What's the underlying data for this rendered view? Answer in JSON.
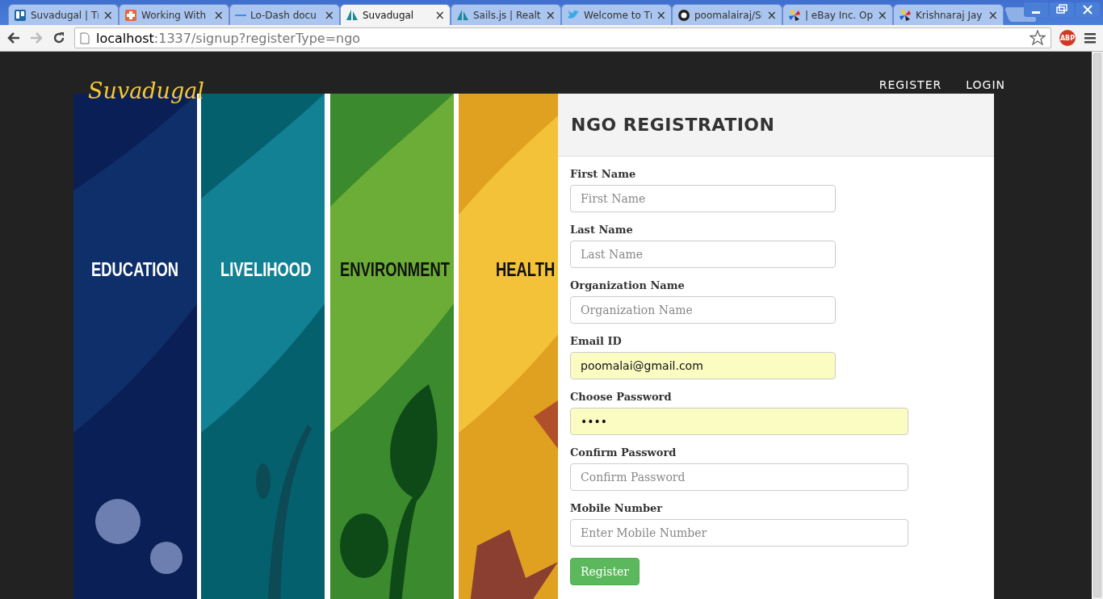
{
  "browser": {
    "tabs": [
      {
        "title": "Suvadugal | Tı",
        "selected": false
      },
      {
        "title": "Working With",
        "selected": false
      },
      {
        "title": "Lo-Dash docu",
        "selected": false
      },
      {
        "title": "Suvadugal",
        "selected": true
      },
      {
        "title": "Sails.js | Realt",
        "selected": false
      },
      {
        "title": "Welcome to Tı",
        "selected": false
      },
      {
        "title": "poomalairaj/Sı",
        "selected": false
      },
      {
        "title": "| eBay Inc. Op",
        "selected": false
      },
      {
        "title": "Krishnaraj Jay",
        "selected": false
      }
    ],
    "close_glyph": "×",
    "address": {
      "host": "localhost",
      "rest": ":1337/signup?registerType=ngo"
    },
    "extension_label": "ABP"
  },
  "site": {
    "logo": "Suvadugal",
    "nav": [
      "REGISTER",
      "LOGIN"
    ]
  },
  "banner": {
    "panels": [
      {
        "label": "EDUCATION"
      },
      {
        "label": "LIVELIHOOD"
      },
      {
        "label": "ENVIRONMENT"
      },
      {
        "label": "HEALTH"
      }
    ]
  },
  "form": {
    "title": "NGO REGISTRATION",
    "fields": [
      {
        "label": "First Name",
        "placeholder": "First Name",
        "kind": "short",
        "autofilled": false
      },
      {
        "label": "Last Name",
        "placeholder": "Last Name",
        "kind": "short",
        "autofilled": false
      },
      {
        "label": "Organization Name",
        "placeholder": "Organization Name",
        "kind": "short",
        "autofilled": false
      },
      {
        "label": "Email ID",
        "value": "poomalai@gmail.com",
        "kind": "short",
        "autofilled": true
      },
      {
        "label": "Choose Password",
        "value": "••••",
        "kind": "long",
        "autofilled": true
      },
      {
        "label": "Confirm Password",
        "placeholder": "Confirm Password",
        "kind": "long",
        "autofilled": false
      },
      {
        "label": "Mobile Number",
        "placeholder": "Enter Mobile Number",
        "kind": "long",
        "autofilled": false
      }
    ],
    "submit": "Register"
  }
}
